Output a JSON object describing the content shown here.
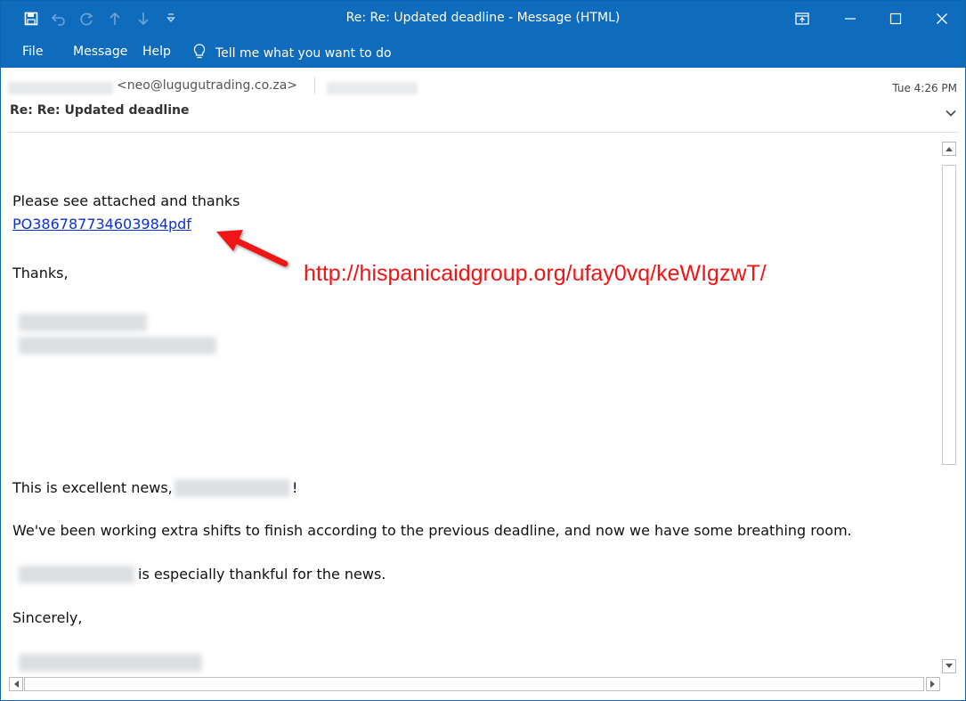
{
  "window": {
    "title": "Re: Re: Updated deadline  -  Message (HTML)",
    "accent_color": "#0f6cbd"
  },
  "menu": {
    "items": [
      "File",
      "Message",
      "Help"
    ],
    "tell_me": "Tell me what you want to do"
  },
  "header": {
    "sender_email": "<neo@lugugutrading.co.za>",
    "date": "Tue 4:26 PM",
    "subject": "Re: Re: Updated deadline"
  },
  "body": {
    "line1": "Please see attached and thanks",
    "attachment_link": "PO386787734603984pdf",
    "thanks": "Thanks,",
    "excellent": "This is excellent news,",
    "excellent_end": "!",
    "shifts": "We've been working extra shifts to finish according to the previous deadline, and now we have some breathing room.",
    "thankful": "is especially thankful for the news.",
    "sincerely": "Sincerely,"
  },
  "annotation": {
    "url": "http://hispanicaidgroup.org/ufay0vq/keWIgzwT/",
    "color": "#f41414"
  }
}
